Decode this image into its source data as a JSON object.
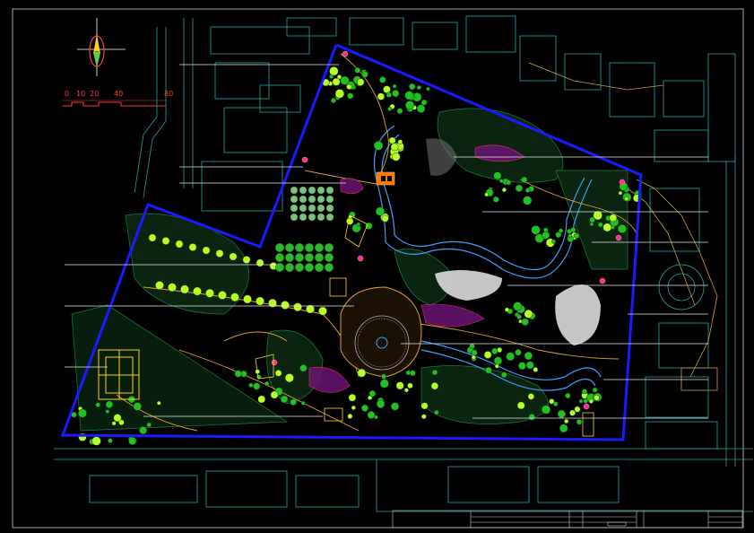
{
  "drawing": {
    "type": "CAD landscape master plan",
    "background": "#000000",
    "boundary_color": "#1a1aff",
    "colors": {
      "trees": "#22c022",
      "bright_trees": "#b8ff2a",
      "flowers": "#ff2e8a",
      "water": "#3aa0ff",
      "paths": "#e0a030",
      "buildings": "#25d0d0",
      "title_block": "#c8c8c8",
      "scale_bar": "#ff3b3b"
    },
    "icons": [
      "north-arrow-icon",
      "scale-bar",
      "tree-symbol",
      "pavilion-symbol"
    ]
  },
  "scale_bar": {
    "labels": [
      "0",
      "10",
      "20",
      "40",
      "80"
    ]
  },
  "title_block": {
    "present": true
  }
}
